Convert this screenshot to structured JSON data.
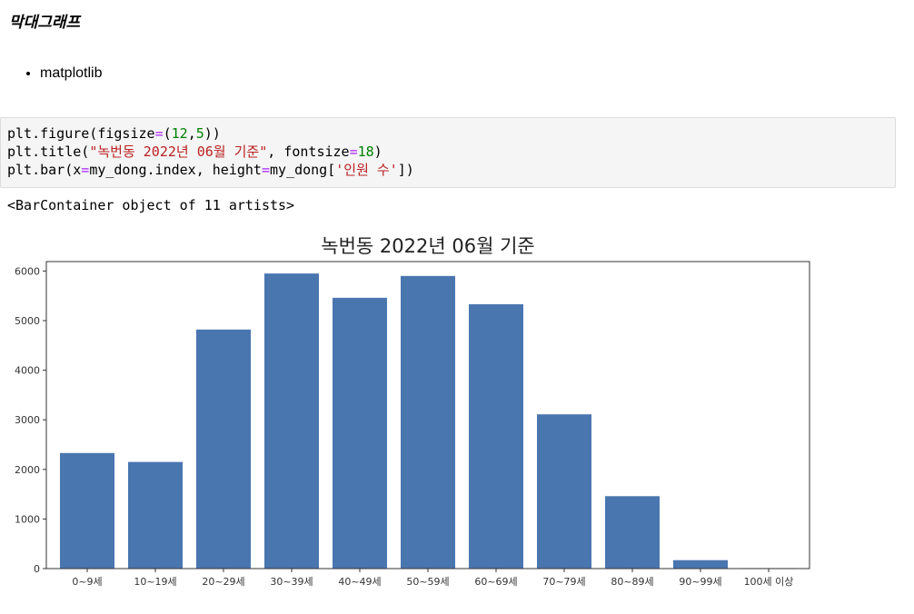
{
  "heading": "막대그래프",
  "bullets": [
    "matplotlib"
  ],
  "code": {
    "lines": [
      [
        {
          "t": "plt.figure(figsize",
          "c": "#000000"
        },
        {
          "t": "=",
          "c": "#aa22ff"
        },
        {
          "t": "(",
          "c": "#000000"
        },
        {
          "t": "12",
          "c": "#008000"
        },
        {
          "t": ",",
          "c": "#000000"
        },
        {
          "t": "5",
          "c": "#008000"
        },
        {
          "t": "))",
          "c": "#000000"
        }
      ],
      [
        {
          "t": "plt.title(",
          "c": "#000000"
        },
        {
          "t": "\"녹번동 2022년 06월 기준\"",
          "c": "#ba2121"
        },
        {
          "t": ", fontsize",
          "c": "#000000"
        },
        {
          "t": "=",
          "c": "#aa22ff"
        },
        {
          "t": "18",
          "c": "#008000"
        },
        {
          "t": ")",
          "c": "#000000"
        }
      ],
      [
        {
          "t": "plt.bar(x",
          "c": "#000000"
        },
        {
          "t": "=",
          "c": "#aa22ff"
        },
        {
          "t": "my_dong.index, height",
          "c": "#000000"
        },
        {
          "t": "=",
          "c": "#aa22ff"
        },
        {
          "t": "my_dong[",
          "c": "#000000"
        },
        {
          "t": "'인원 수'",
          "c": "#ba2121"
        },
        {
          "t": "])",
          "c": "#000000"
        }
      ]
    ]
  },
  "output_text": "<BarContainer object of 11 artists>",
  "chart_data": {
    "type": "bar",
    "title": "녹번동 2022년 06월 기준",
    "xlabel": "",
    "ylabel": "",
    "categories": [
      "0~9세",
      "10~19세",
      "20~29세",
      "30~39세",
      "40~49세",
      "50~59세",
      "60~69세",
      "70~79세",
      "80~89세",
      "90~99세",
      "100세 이상"
    ],
    "values": [
      2330,
      2150,
      4820,
      5950,
      5460,
      5900,
      5330,
      3110,
      1460,
      170,
      10
    ],
    "ylim": [
      0,
      6190
    ],
    "yticks": [
      0,
      1000,
      2000,
      3000,
      4000,
      5000,
      6000
    ],
    "bar_color": "#4a76b0",
    "grid": false
  }
}
